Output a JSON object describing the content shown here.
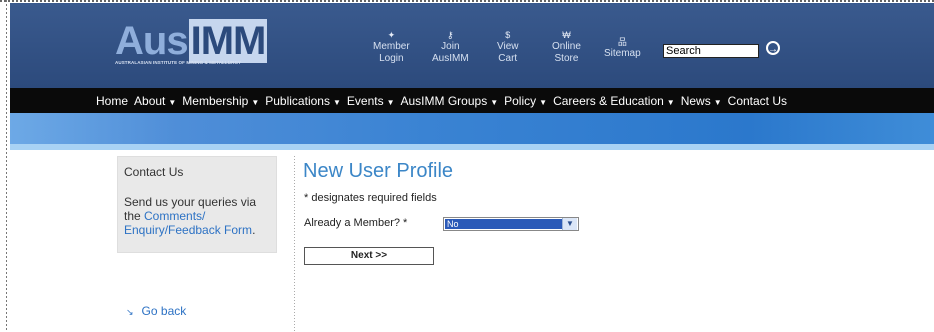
{
  "logo": {
    "name": "AusIMM",
    "prefix": "Aus",
    "suffix": "IMM",
    "tagline": "AUSTRALASIAN INSTITUTE OF MINING & METALLURGY"
  },
  "toolbar": {
    "items": [
      {
        "icon": "person-icon",
        "glyph": "✦",
        "line1": "Member",
        "line2": "Login"
      },
      {
        "icon": "key-icon",
        "glyph": "⚷",
        "line1": "Join",
        "line2": "AusIMM"
      },
      {
        "icon": "dollar-icon",
        "glyph": "$",
        "line1": "View",
        "line2": "Cart"
      },
      {
        "icon": "store-icon",
        "glyph": "₩",
        "line1": "Online",
        "line2": "Store"
      },
      {
        "icon": "sitemap-icon",
        "glyph": "品",
        "line1": "Sitemap",
        "line2": ""
      }
    ],
    "search_value": "Search",
    "go_glyph": "→"
  },
  "nav": {
    "items": [
      {
        "label": "Home",
        "dropdown": false
      },
      {
        "label": "About",
        "dropdown": true
      },
      {
        "label": "Membership",
        "dropdown": true
      },
      {
        "label": "Publications",
        "dropdown": true
      },
      {
        "label": "Events",
        "dropdown": true
      },
      {
        "label": "AusIMM Groups",
        "dropdown": true
      },
      {
        "label": "Policy",
        "dropdown": true
      },
      {
        "label": "Careers & Education",
        "dropdown": true
      },
      {
        "label": "News",
        "dropdown": true
      },
      {
        "label": "Contact Us",
        "dropdown": false
      }
    ],
    "caret": "▼"
  },
  "sidebar": {
    "title": "Contact Us",
    "text_before": "Send us your queries via the ",
    "link_text": "Comments/ Enquiry/Feedback Form",
    "text_after": ".",
    "go_back": "Go back",
    "go_back_glyph": "↘"
  },
  "form": {
    "title": "New User Profile",
    "required_note": "* designates required fields",
    "member_label": "Already a Member? *",
    "member_value": "No",
    "next_label": "Next >>"
  },
  "colors": {
    "header": "#2c4a7c",
    "nav": "#0a0a0a",
    "link": "#2d72c4",
    "title": "#3b86c7"
  }
}
